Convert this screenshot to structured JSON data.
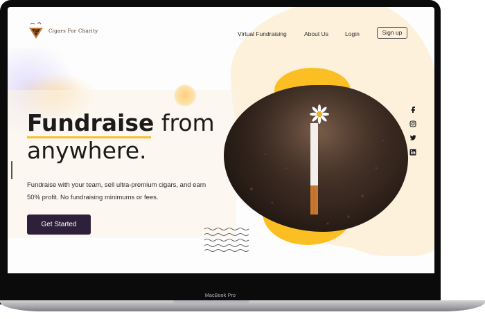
{
  "brand": {
    "name": "Cigars For Charity"
  },
  "nav": {
    "items": [
      {
        "label": "Virtual Fundraising"
      },
      {
        "label": "About Us"
      },
      {
        "label": "Login"
      }
    ],
    "signup_label": "Sign up"
  },
  "hero": {
    "headline_strong": "Fundraise",
    "headline_rest": " from",
    "headline_line2": "anywhere.",
    "subtitle": "Fundraise with your team, sell ultra-premium cigars, and earn 50% profit. No fundraising minimums or fees.",
    "cta_label": "Get Started"
  },
  "social": [
    "facebook-icon",
    "instagram-icon",
    "twitter-icon",
    "linkedin-icon"
  ],
  "device": {
    "label": "MacBook Pro"
  },
  "colors": {
    "accent_yellow": "#fbbf24",
    "cta_bg": "#2e1f3a",
    "cream": "#fdf1dc",
    "brand_brown": "#4a3426"
  }
}
